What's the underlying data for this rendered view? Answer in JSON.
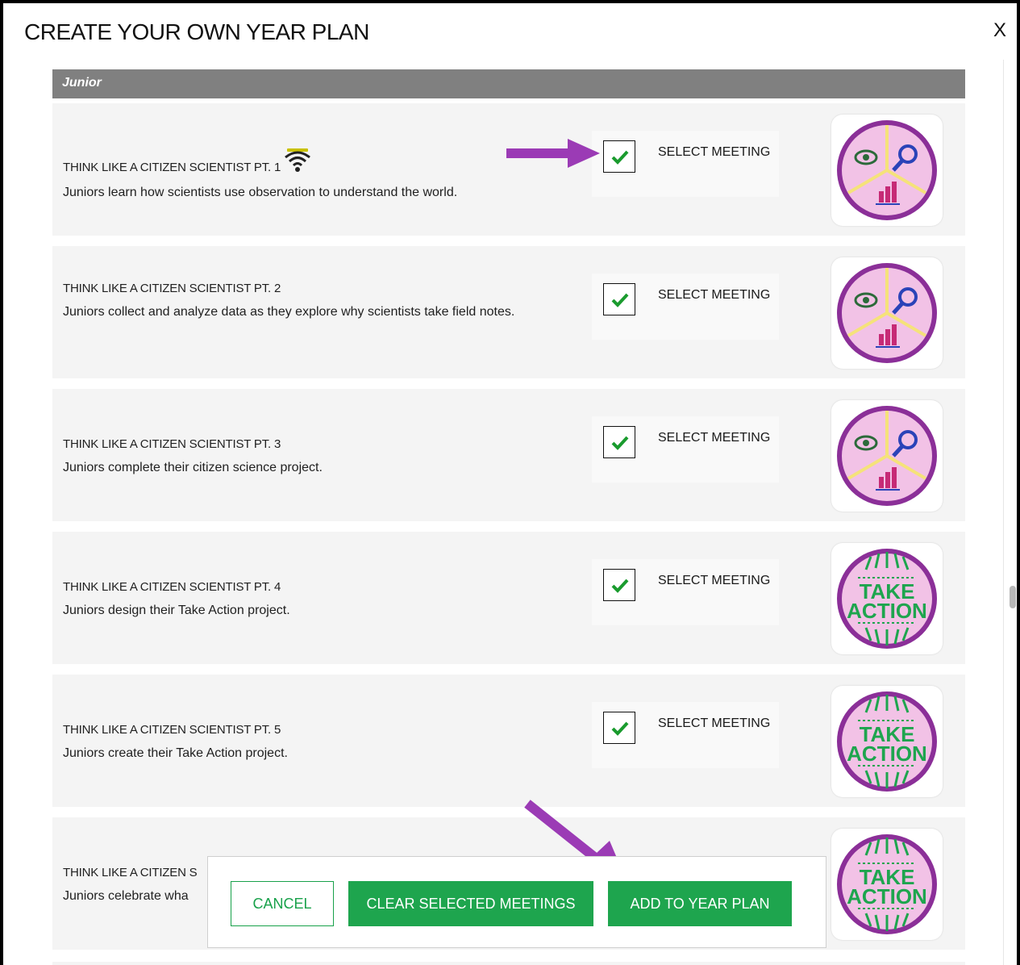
{
  "dialog": {
    "title": "CREATE YOUR OWN YEAR PLAN",
    "close_label": "X"
  },
  "section": {
    "label": "Junior"
  },
  "select_label": "SELECT MEETING",
  "meetings": [
    {
      "title": "THINK LIKE A CITIZEN SCIENTIST PT. 1",
      "desc": "Juniors learn how scientists use observation to understand the world.",
      "selected": true,
      "badge": "citizen-scientist-badge"
    },
    {
      "title": "THINK LIKE A CITIZEN SCIENTIST PT. 2",
      "desc": "Juniors collect and analyze data as they explore why scientists take field notes.",
      "selected": true,
      "badge": "citizen-scientist-badge"
    },
    {
      "title": "THINK LIKE A CITIZEN SCIENTIST PT. 3",
      "desc": "Juniors complete their citizen science project.",
      "selected": true,
      "badge": "citizen-scientist-badge"
    },
    {
      "title": "THINK LIKE A CITIZEN SCIENTIST PT. 4",
      "desc": "Juniors design their Take Action project.",
      "selected": true,
      "badge": "take-action-badge"
    },
    {
      "title": "THINK LIKE A CITIZEN SCIENTIST PT. 5",
      "desc": "Juniors create their Take Action project.",
      "selected": true,
      "badge": "take-action-badge"
    },
    {
      "title": "THINK LIKE A CITIZEN S",
      "desc": "Juniors celebrate wha",
      "selected": true,
      "badge": "take-action-badge"
    }
  ],
  "badge_text": {
    "line1": "TAKE",
    "line2": "ACTION"
  },
  "actions": {
    "cancel": "CANCEL",
    "clear": "CLEAR SELECTED MEETINGS",
    "add": "ADD TO YEAR PLAN"
  },
  "colors": {
    "accent_green": "#1ea54e",
    "badge_purple": "#8b2f98",
    "badge_pink": "#f2c2e6",
    "arrow_purple": "#9b3bb5",
    "header_gray": "#808080"
  }
}
